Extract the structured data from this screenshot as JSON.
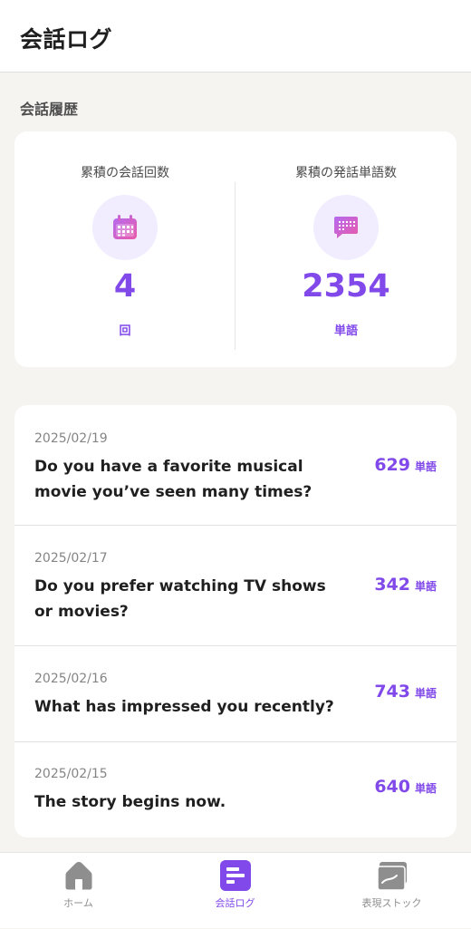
{
  "header": {
    "title": "会話ログ"
  },
  "section": {
    "title": "会話履歴"
  },
  "stats": {
    "conversations": {
      "label": "累積の会話回数",
      "value": "4",
      "unit": "回",
      "icon": "calendar-icon"
    },
    "words": {
      "label": "累積の発話単語数",
      "value": "2354",
      "unit": "単語",
      "icon": "chat-bubble-icon"
    }
  },
  "logs": [
    {
      "date": "2025/02/19",
      "title": "Do you have a favorite musical movie you’ve seen many times?",
      "count": "629",
      "unit": "単語"
    },
    {
      "date": "2025/02/17",
      "title": "Do you prefer watching TV shows or movies?",
      "count": "342",
      "unit": "単語"
    },
    {
      "date": "2025/02/16",
      "title": "What has impressed you recently?",
      "count": "743",
      "unit": "単語"
    },
    {
      "date": "2025/02/15",
      "title": "The story begins now.",
      "count": "640",
      "unit": "単語"
    }
  ],
  "tabs": [
    {
      "label": "ホーム",
      "icon": "home-icon",
      "active": false
    },
    {
      "label": "会話ログ",
      "icon": "conversation-log-icon",
      "active": true
    },
    {
      "label": "表現ストック",
      "icon": "card-stock-icon",
      "active": false
    }
  ],
  "colors": {
    "accent": "#8149ea",
    "icon_gradient_start": "#b56af0",
    "icon_gradient_end": "#ea5aa8"
  }
}
